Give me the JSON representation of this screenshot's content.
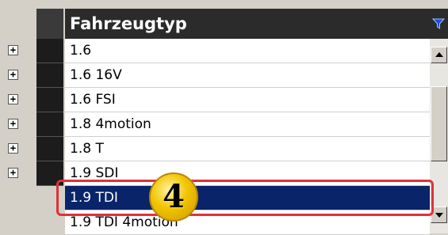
{
  "grid": {
    "column_header": "Fahrzeugtyp",
    "filter_icon": "filter-funnel-icon",
    "rows": [
      {
        "label": "1.6",
        "expander": "+",
        "selected": false
      },
      {
        "label": "1.6 16V",
        "expander": "+",
        "selected": false
      },
      {
        "label": "1.6 FSI",
        "expander": "+",
        "selected": false
      },
      {
        "label": "1.8  4motion",
        "expander": "+",
        "selected": false
      },
      {
        "label": "1.8 T",
        "expander": "+",
        "selected": false
      },
      {
        "label": "1.9 SDI",
        "expander": "+",
        "selected": false
      },
      {
        "label": "1.9 TDI",
        "expander": "",
        "selected": true
      },
      {
        "label": "1.9 TDI 4motion",
        "expander": "",
        "selected": false
      }
    ]
  },
  "annotation": {
    "step_badge": "4",
    "highlight_color": "#e0303a",
    "badge_color": "#f2c400"
  },
  "colors": {
    "selection": "#0a246a",
    "header_bg": "#2b2b2b",
    "filter_icon": "#1f4fd8"
  }
}
